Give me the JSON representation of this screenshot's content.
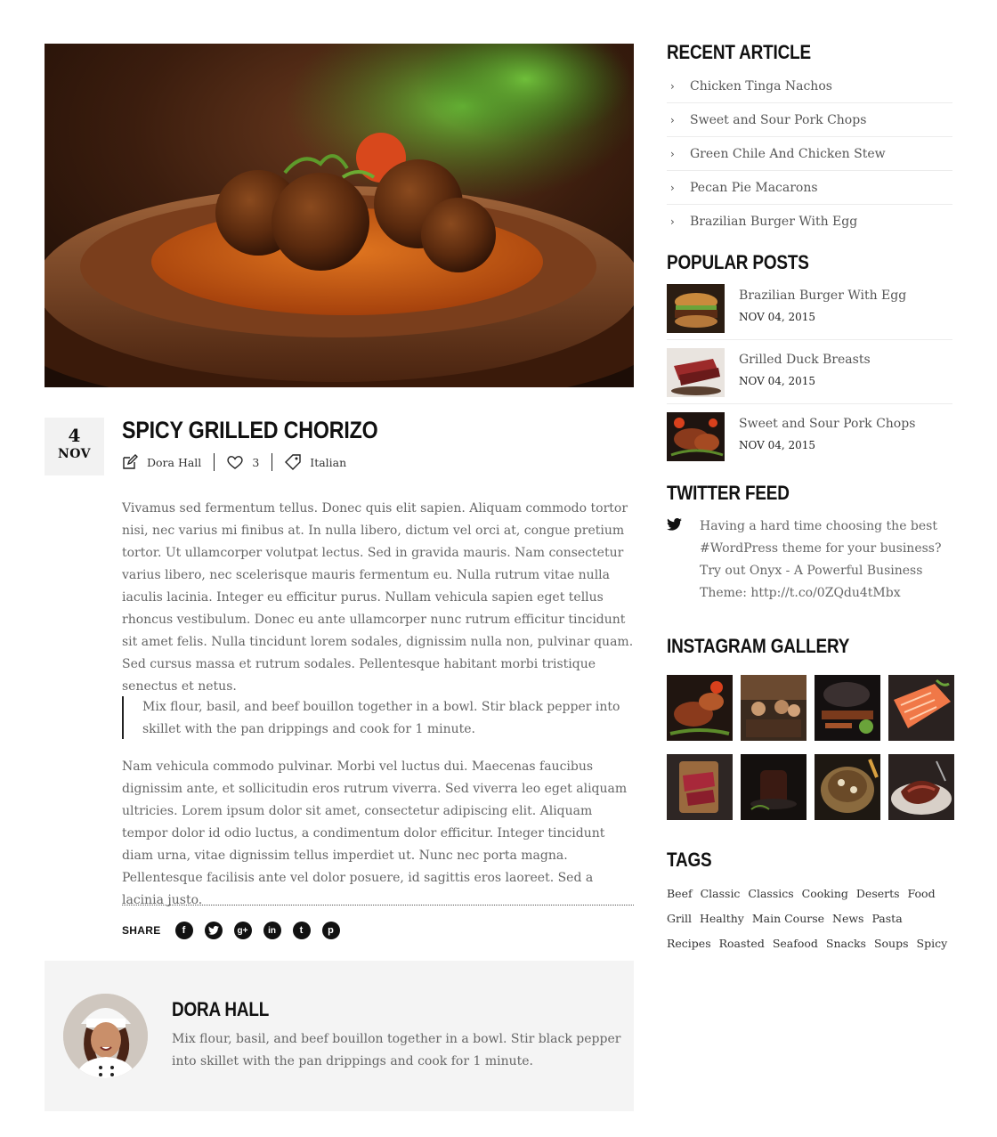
{
  "post": {
    "date_day": "4",
    "date_month": "NOV",
    "title": "SPICY GRILLED CHORIZO",
    "author": "Dora Hall",
    "likes": "3",
    "category": "Italian",
    "paragraph1": "Vivamus sed fermentum tellus. Donec quis elit sapien. Aliquam commodo tortor nisi, nec varius mi finibus at. In nulla libero, dictum vel orci at, congue pretium tortor. Ut ullamcorper volutpat lectus. Sed in gravida mauris. Nam consectetur varius libero, nec scelerisque mauris fermentum eu. Nulla rutrum vitae nulla iaculis lacinia. Integer eu efficitur purus. Nullam vehicula sapien eget tellus rhoncus vestibulum. Donec eu ante ullamcorper nunc rutrum efficitur tincidunt sit amet felis. Nulla tincidunt lorem sodales, dignissim nulla non, pulvinar quam. Sed cursus massa et rutrum sodales. Pellentesque habitant morbi tristique senectus et netus.",
    "quote": "Mix flour, basil, and beef bouillon together in a bowl. Stir black pepper into skillet with the pan drippings and cook for 1 minute.",
    "paragraph2": "Nam vehicula commodo pulvinar. Morbi vel luctus dui. Maecenas faucibus dignissim ante, et sollicitudin eros rutrum viverra. Sed viverra leo eget aliquam ultricies. Lorem ipsum dolor sit amet, consectetur adipiscing elit. Aliquam tempor dolor id odio luctus, a condimentum dolor efficitur. Integer tincidunt diam urna, vitae dignissim tellus imperdiet ut. Nunc nec porta magna. Pellentesque facilisis ante vel dolor posuere, id sagittis eros laoreet. Sed a lacinia justo."
  },
  "share": {
    "label": "SHARE",
    "icons": [
      "facebook-icon",
      "twitter-icon",
      "google-plus-icon",
      "linkedin-icon",
      "tumblr-icon",
      "pinterest-icon"
    ]
  },
  "author_box": {
    "name": "DORA HALL",
    "bio": "Mix flour, basil, and beef bouillon together in a bowl. Stir black pepper into skillet with the pan drippings and cook for 1 minute."
  },
  "sidebar": {
    "recent_heading": "RECENT ARTICLE",
    "recent": [
      "Chicken Tinga Nachos",
      "Sweet and Sour Pork Chops",
      "Green Chile And Chicken Stew",
      "Pecan Pie Macarons",
      "Brazilian Burger With Egg"
    ],
    "popular_heading": "POPULAR POSTS",
    "popular": [
      {
        "title": "Brazilian Burger With Egg",
        "date": "NOV 04, 2015"
      },
      {
        "title": "Grilled Duck Breasts",
        "date": "NOV 04, 2015"
      },
      {
        "title": "Sweet and Sour Pork Chops",
        "date": "NOV 04, 2015"
      }
    ],
    "twitter_heading": "TWITTER FEED",
    "tweet": "Having a hard time choosing the best #WordPress theme for your business? Try out Onyx - A Powerful Business Theme: http://t.co/0ZQdu4tMbx",
    "instagram_heading": "INSTAGRAM GALLERY",
    "tags_heading": "TAGS",
    "tags": [
      "Beef",
      "Classic",
      "Classics",
      "Cooking",
      "Deserts",
      "Food",
      "Grill",
      "Healthy",
      "Main Course",
      "News",
      "Pasta",
      "Recipes",
      "Roasted",
      "Seafood",
      "Snacks",
      "Soups",
      "Spicy"
    ]
  },
  "colors": {
    "heading": "#111111",
    "body_text": "#666666",
    "panel_bg": "#f4f4f4",
    "date_bg": "#f2f2f2"
  }
}
